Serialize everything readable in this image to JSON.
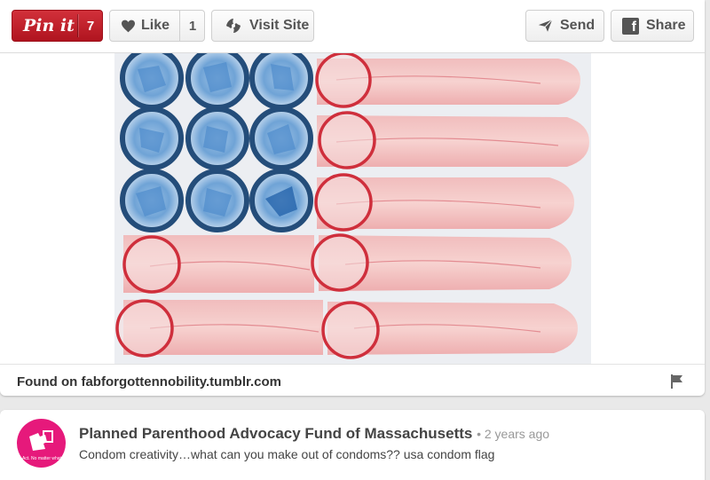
{
  "toolbar": {
    "pinit": {
      "label": "Pin it",
      "count": "7"
    },
    "like": {
      "label": "Like",
      "count": "1"
    },
    "visit": {
      "label": "Visit Site"
    },
    "send": {
      "label": "Send"
    },
    "share": {
      "label": "Share"
    }
  },
  "pin": {
    "image_alt": "USA flag made of red and blue condoms",
    "source_text": "Found on fabforgottennobility.tumblr.com"
  },
  "pinner": {
    "name": "Planned Parenthood Advocacy Fund of Massachusetts",
    "time": "• 2 years ago",
    "avatar_caption": "Act. No matter what",
    "description": "Condom creativity…what can you make out of condoms?? usa condom flag"
  },
  "colors": {
    "pinit_red": "#bd1e28",
    "avatar_pink": "#e6197b",
    "condom_blue": "#2b5f96",
    "condom_red": "#d63b48"
  },
  "icons": [
    "heart-icon",
    "visit-site-icon",
    "send-icon",
    "facebook-icon",
    "flag-report-icon"
  ]
}
